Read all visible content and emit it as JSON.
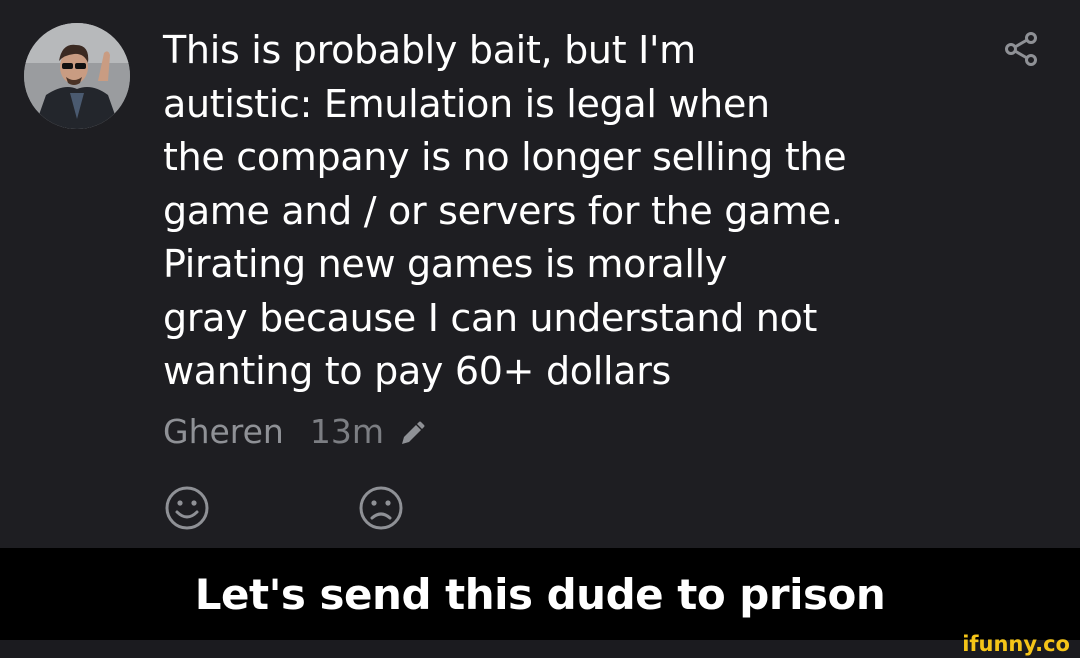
{
  "post": {
    "avatar_icon": "user-avatar",
    "share_icon": "share-icon",
    "lines": [
      "This is probably bait, but I'm",
      "autistic: Emulation is legal when",
      "the company is no longer selling the",
      "game and / or servers for the game.",
      "Pirating new games is morally",
      "gray because I can understand not",
      "wanting to pay 60+ dollars"
    ],
    "author": "Gheren",
    "time": "13m",
    "edit_icon": "pencil-icon",
    "reactions": [
      "smile-icon",
      "frown-icon"
    ]
  },
  "caption": "Let's send this dude to prison",
  "watermark": "ifunny.co",
  "colors": {
    "background": "#1e1e22",
    "caption_bg": "#000000",
    "text": "#ffffff",
    "meta": "#8f9196",
    "brand": "#f5c518"
  }
}
